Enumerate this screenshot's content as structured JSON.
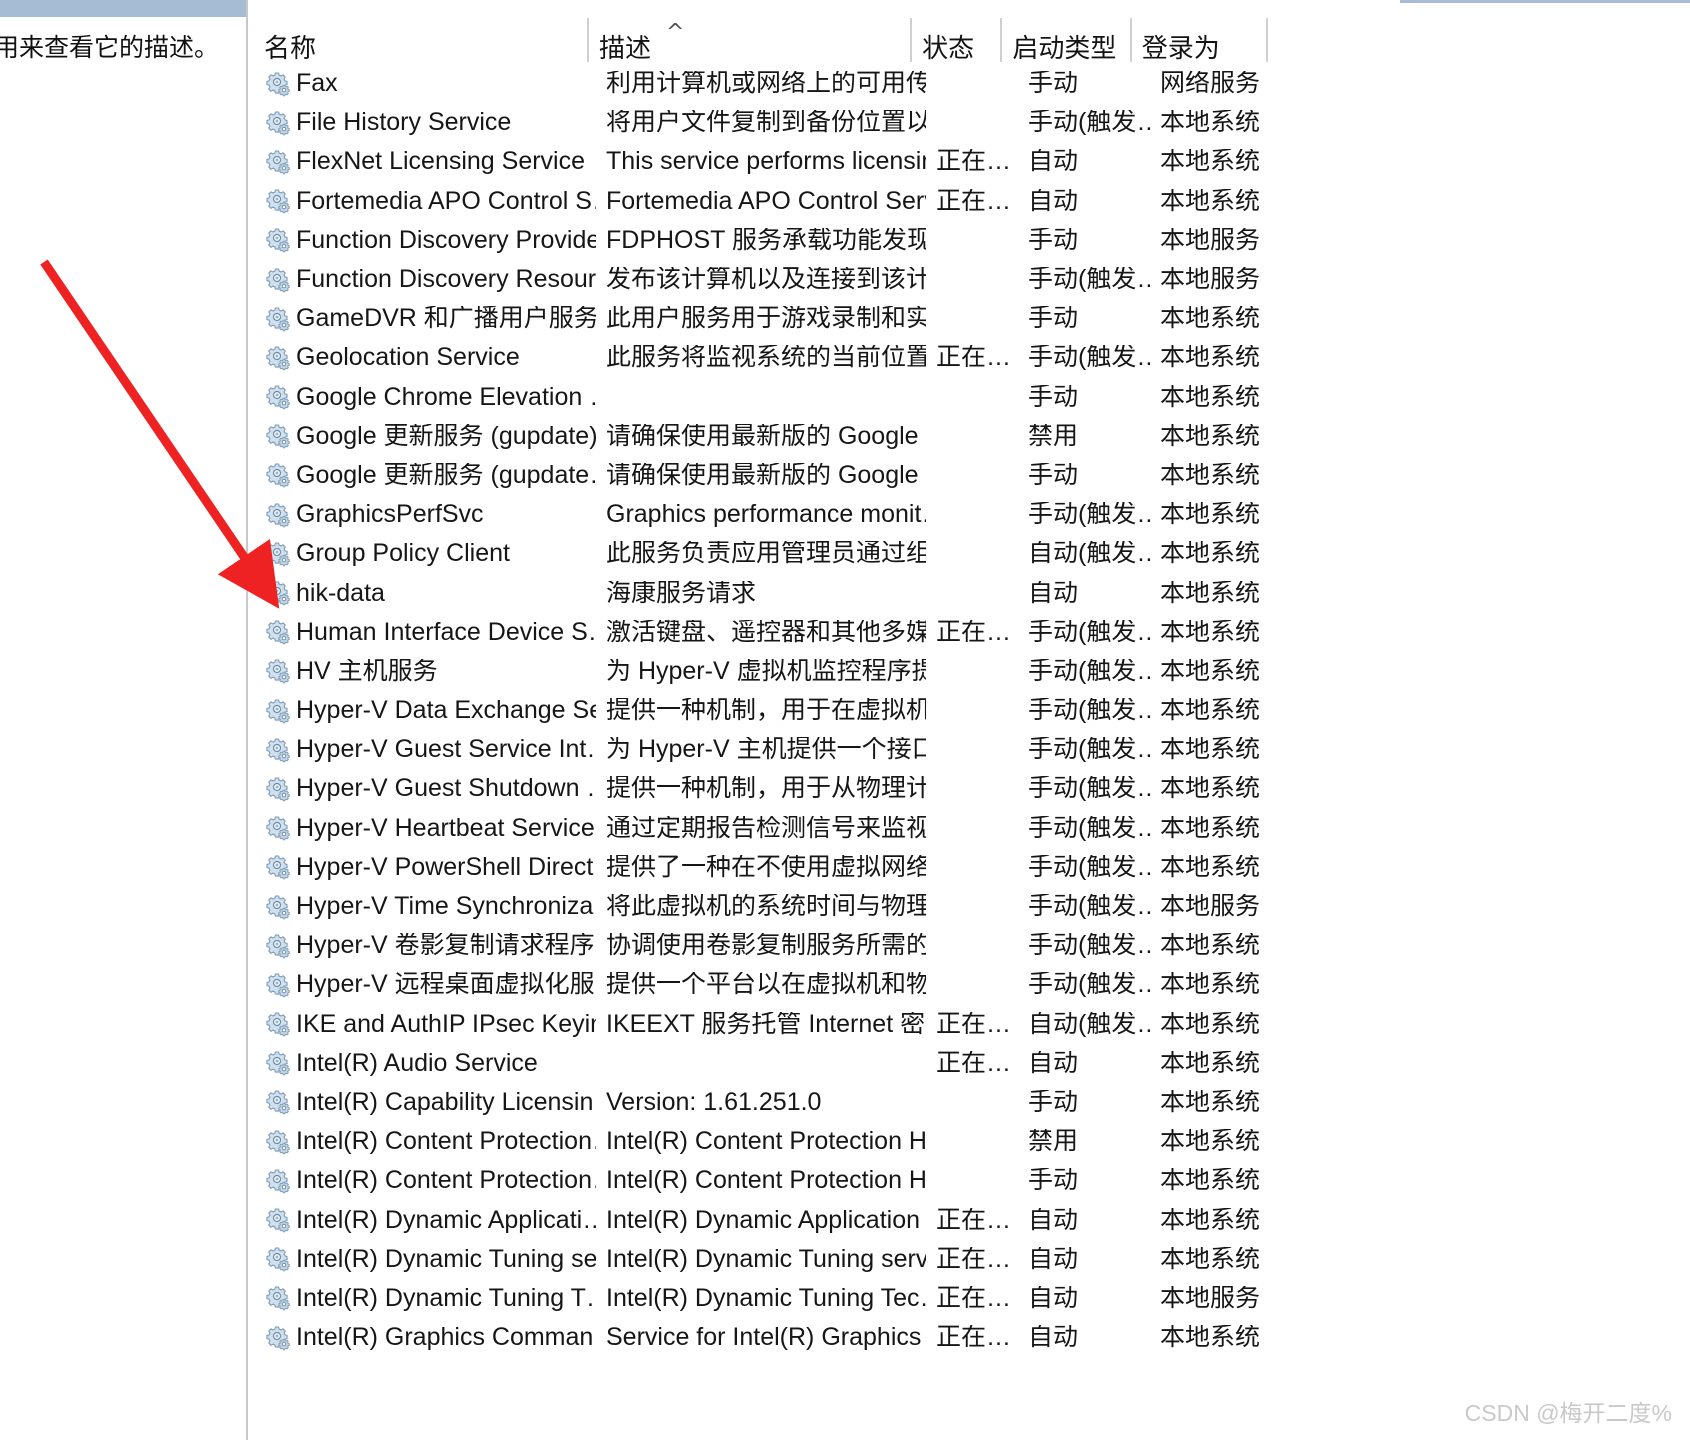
{
  "window": {
    "left_panel_text": "用来查看它的描述。",
    "chrome_color": "#a6bcd4"
  },
  "table": {
    "sort_indicator": "⌃",
    "sort_column": "名称",
    "sort_direction": "ascending",
    "columns": [
      {
        "key": "name",
        "label": "名称"
      },
      {
        "key": "desc",
        "label": "描述"
      },
      {
        "key": "state",
        "label": "状态"
      },
      {
        "key": "start",
        "label": "启动类型"
      },
      {
        "key": "logon",
        "label": "登录为"
      }
    ],
    "rows": [
      {
        "icon": "gear-icon",
        "name": "Fax",
        "desc": "利用计算机或网络上的可用传…",
        "state": "",
        "start": "手动",
        "logon": "网络服务"
      },
      {
        "icon": "gear-icon",
        "name": "File History Service",
        "desc": "将用户文件复制到备份位置以…",
        "state": "",
        "start": "手动(触发…",
        "logon": "本地系统"
      },
      {
        "icon": "gear-icon",
        "name": "FlexNet Licensing Service",
        "desc": "This service performs licensin…",
        "state": "正在…",
        "start": "自动",
        "logon": "本地系统"
      },
      {
        "icon": "gear-icon",
        "name": "Fortemedia APO Control S…",
        "desc": "Fortemedia APO Control Serv…",
        "state": "正在…",
        "start": "自动",
        "logon": "本地系统"
      },
      {
        "icon": "gear-icon",
        "name": "Function Discovery Provide…",
        "desc": "FDPHOST 服务承载功能发现(…",
        "state": "",
        "start": "手动",
        "logon": "本地服务"
      },
      {
        "icon": "gear-icon",
        "name": "Function Discovery Resour…",
        "desc": "发布该计算机以及连接到该计…",
        "state": "",
        "start": "手动(触发…",
        "logon": "本地服务"
      },
      {
        "icon": "gear-icon",
        "name": "GameDVR 和广播用户服务…",
        "desc": "此用户服务用于游戏录制和实…",
        "state": "",
        "start": "手动",
        "logon": "本地系统"
      },
      {
        "icon": "gear-icon",
        "name": "Geolocation Service",
        "desc": "此服务将监视系统的当前位置…",
        "state": "正在…",
        "start": "手动(触发…",
        "logon": "本地系统"
      },
      {
        "icon": "gear-icon",
        "name": "Google Chrome Elevation …",
        "desc": "",
        "state": "",
        "start": "手动",
        "logon": "本地系统"
      },
      {
        "icon": "gear-icon",
        "name": "Google 更新服务 (gupdate)",
        "desc": "请确保使用最新版的 Google …",
        "state": "",
        "start": "禁用",
        "logon": "本地系统"
      },
      {
        "icon": "gear-icon",
        "name": "Google 更新服务 (gupdate…",
        "desc": "请确保使用最新版的 Google …",
        "state": "",
        "start": "手动",
        "logon": "本地系统"
      },
      {
        "icon": "gear-icon",
        "name": "GraphicsPerfSvc",
        "desc": "Graphics performance monit…",
        "state": "",
        "start": "手动(触发…",
        "logon": "本地系统"
      },
      {
        "icon": "gear-icon",
        "name": "Group Policy Client",
        "desc": "此服务负责应用管理员通过组…",
        "state": "",
        "start": "自动(触发…",
        "logon": "本地系统"
      },
      {
        "icon": "gear-icon",
        "name": "hik-data",
        "desc": "海康服务请求",
        "state": "",
        "start": "自动",
        "logon": "本地系统",
        "highlighted": true
      },
      {
        "icon": "gear-icon",
        "name": "Human Interface Device S…",
        "desc": "激活键盘、遥控器和其他多媒…",
        "state": "正在…",
        "start": "手动(触发…",
        "logon": "本地系统"
      },
      {
        "icon": "gear-icon",
        "name": "HV 主机服务",
        "desc": "为 Hyper-V 虚拟机监控程序提…",
        "state": "",
        "start": "手动(触发…",
        "logon": "本地系统"
      },
      {
        "icon": "gear-icon",
        "name": "Hyper-V Data Exchange Se…",
        "desc": "提供一种机制，用于在虚拟机…",
        "state": "",
        "start": "手动(触发…",
        "logon": "本地系统"
      },
      {
        "icon": "gear-icon",
        "name": "Hyper-V Guest Service Int…",
        "desc": "为 Hyper-V 主机提供一个接口…",
        "state": "",
        "start": "手动(触发…",
        "logon": "本地系统"
      },
      {
        "icon": "gear-icon",
        "name": "Hyper-V Guest Shutdown …",
        "desc": "提供一种机制，用于从物理计…",
        "state": "",
        "start": "手动(触发…",
        "logon": "本地系统"
      },
      {
        "icon": "gear-icon",
        "name": "Hyper-V Heartbeat Service",
        "desc": "通过定期报告检测信号来监视…",
        "state": "",
        "start": "手动(触发…",
        "logon": "本地系统"
      },
      {
        "icon": "gear-icon",
        "name": "Hyper-V PowerShell Direct…",
        "desc": "提供了一种在不使用虚拟网络…",
        "state": "",
        "start": "手动(触发…",
        "logon": "本地系统"
      },
      {
        "icon": "gear-icon",
        "name": "Hyper-V Time Synchroniza…",
        "desc": "将此虚拟机的系统时间与物理…",
        "state": "",
        "start": "手动(触发…",
        "logon": "本地服务"
      },
      {
        "icon": "gear-icon",
        "name": "Hyper-V 卷影复制请求程序",
        "desc": "协调使用卷影复制服务所需的…",
        "state": "",
        "start": "手动(触发…",
        "logon": "本地系统"
      },
      {
        "icon": "gear-icon",
        "name": "Hyper-V 远程桌面虚拟化服…",
        "desc": "提供一个平台以在虚拟机和物…",
        "state": "",
        "start": "手动(触发…",
        "logon": "本地系统"
      },
      {
        "icon": "gear-icon",
        "name": "IKE and AuthIP IPsec Keyin…",
        "desc": "IKEEXT 服务托管 Internet 密钥…",
        "state": "正在…",
        "start": "自动(触发…",
        "logon": "本地系统"
      },
      {
        "icon": "gear-icon",
        "name": "Intel(R) Audio Service",
        "desc": "",
        "state": "正在…",
        "start": "自动",
        "logon": "本地系统"
      },
      {
        "icon": "gear-icon",
        "name": "Intel(R) Capability Licensin…",
        "desc": "Version: 1.61.251.0",
        "state": "",
        "start": "手动",
        "logon": "本地系统"
      },
      {
        "icon": "gear-icon",
        "name": "Intel(R) Content Protection…",
        "desc": "Intel(R) Content Protection H…",
        "state": "",
        "start": "禁用",
        "logon": "本地系统"
      },
      {
        "icon": "gear-icon",
        "name": "Intel(R) Content Protection…",
        "desc": "Intel(R) Content Protection H…",
        "state": "",
        "start": "手动",
        "logon": "本地系统"
      },
      {
        "icon": "gear-icon",
        "name": "Intel(R) Dynamic Applicati…",
        "desc": "Intel(R) Dynamic Application …",
        "state": "正在…",
        "start": "自动",
        "logon": "本地系统"
      },
      {
        "icon": "gear-icon",
        "name": "Intel(R) Dynamic Tuning se…",
        "desc": "Intel(R) Dynamic Tuning servi…",
        "state": "正在…",
        "start": "自动",
        "logon": "本地系统"
      },
      {
        "icon": "gear-icon",
        "name": "Intel(R) Dynamic Tuning T…",
        "desc": "Intel(R) Dynamic Tuning Tec…",
        "state": "正在…",
        "start": "自动",
        "logon": "本地服务"
      },
      {
        "icon": "gear-icon",
        "name": "Intel(R) Graphics Comman…",
        "desc": "Service for Intel(R) Graphics …",
        "state": "正在…",
        "start": "自动",
        "logon": "本地系统"
      }
    ]
  },
  "annotation": {
    "arrow_color": "#ee2222",
    "arrow_target": "hik-data"
  },
  "watermark": {
    "text": "CSDN @梅开二度%",
    "color": "#c9c9c9"
  }
}
